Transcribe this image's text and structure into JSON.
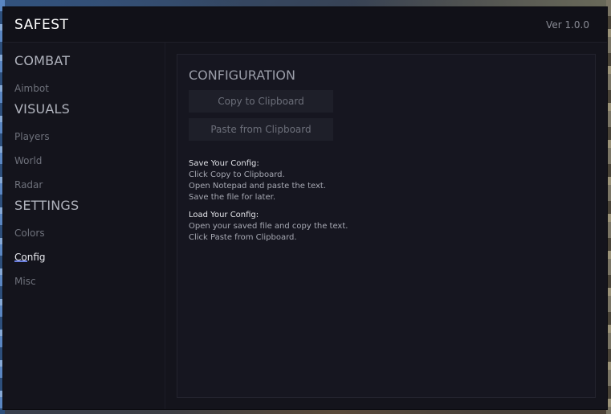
{
  "app": {
    "title": "SAFEST",
    "version": "Ver 1.0.0"
  },
  "sidebar": {
    "sections": [
      {
        "heading": "COMBAT",
        "items": [
          "Aimbot"
        ]
      },
      {
        "heading": "VISUALS",
        "items": [
          "Players",
          "World",
          "Radar"
        ]
      },
      {
        "heading": "SETTINGS",
        "items": [
          "Colors",
          "Config",
          "Misc"
        ]
      }
    ],
    "active_item": "Config",
    "accent_color": "#6b7fe0"
  },
  "config": {
    "title": "CONFIGURATION",
    "copy_button": "Copy to Clipboard",
    "paste_button": "Paste from Clipboard",
    "save_help": {
      "title": "Save Your Config:",
      "lines": [
        "Click Copy to Clipboard.",
        "Open Notepad and paste the text.",
        "Save the file for later."
      ]
    },
    "load_help": {
      "title": "Load Your Config:",
      "lines": [
        "Open your saved file and copy the text.",
        "Click Paste from Clipboard."
      ]
    }
  }
}
